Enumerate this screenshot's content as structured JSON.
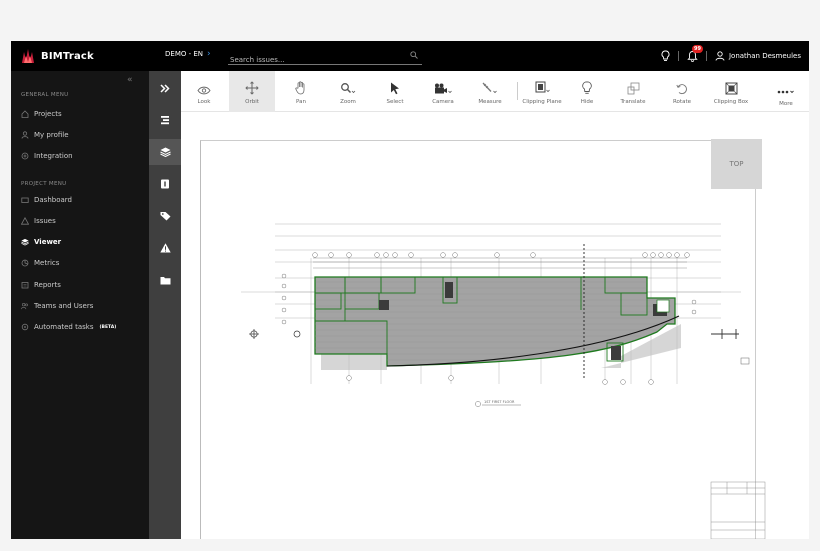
{
  "app": {
    "name": "BIMTrack",
    "project": "DEMO - EN",
    "search_placeholder": "Search issues...",
    "notifications_count": "99",
    "user_name": "Jonathan Desmeules"
  },
  "sidebar": {
    "general_heading": "GENERAL MENU",
    "general_items": [
      {
        "label": "Projects",
        "icon": "home-icon"
      },
      {
        "label": "My profile",
        "icon": "user-icon"
      },
      {
        "label": "Integration",
        "icon": "integration-icon"
      }
    ],
    "project_heading": "PROJECT MENU",
    "project_items": [
      {
        "label": "Dashboard",
        "icon": "dashboard-icon"
      },
      {
        "label": "Issues",
        "icon": "warning-icon"
      },
      {
        "label": "Viewer",
        "icon": "viewer-icon",
        "active": true
      },
      {
        "label": "Metrics",
        "icon": "metrics-icon"
      },
      {
        "label": "Reports",
        "icon": "reports-icon"
      },
      {
        "label": "Teams and Users",
        "icon": "team-icon"
      },
      {
        "label": "Automated tasks",
        "icon": "automation-icon",
        "badge": "(BETA)"
      }
    ]
  },
  "toolbar": {
    "tools": [
      {
        "label": "Look",
        "icon": "eye-icon"
      },
      {
        "label": "Orbit",
        "icon": "orbit-icon",
        "active": true
      },
      {
        "label": "Pan",
        "icon": "hand-icon"
      },
      {
        "label": "Zoom",
        "icon": "zoom-icon"
      },
      {
        "label": "Select",
        "icon": "cursor-icon"
      },
      {
        "label": "Camera",
        "icon": "camera-icon"
      },
      {
        "label": "Measure",
        "icon": "measure-icon"
      },
      {
        "label": "Clipping Plane",
        "icon": "clipping-plane-icon"
      },
      {
        "label": "Hide",
        "icon": "bulb-icon"
      },
      {
        "label": "Translate",
        "icon": "translate-icon"
      },
      {
        "label": "Rotate",
        "icon": "rotate-icon"
      },
      {
        "label": "Clipping Box",
        "icon": "clipping-box-icon"
      },
      {
        "label": "More",
        "icon": "more-icon"
      }
    ]
  },
  "viewer": {
    "view_cube_label": "TOP",
    "drawing_caption": "1ST FIRST FLOOR"
  },
  "colors": {
    "topbar": "#000000",
    "sidebar": "#151515",
    "rail": "#3f3f3f",
    "accent_blue": "#3b8ede",
    "badge_red": "#e02020",
    "slab_outline": "#1f7a1f"
  }
}
